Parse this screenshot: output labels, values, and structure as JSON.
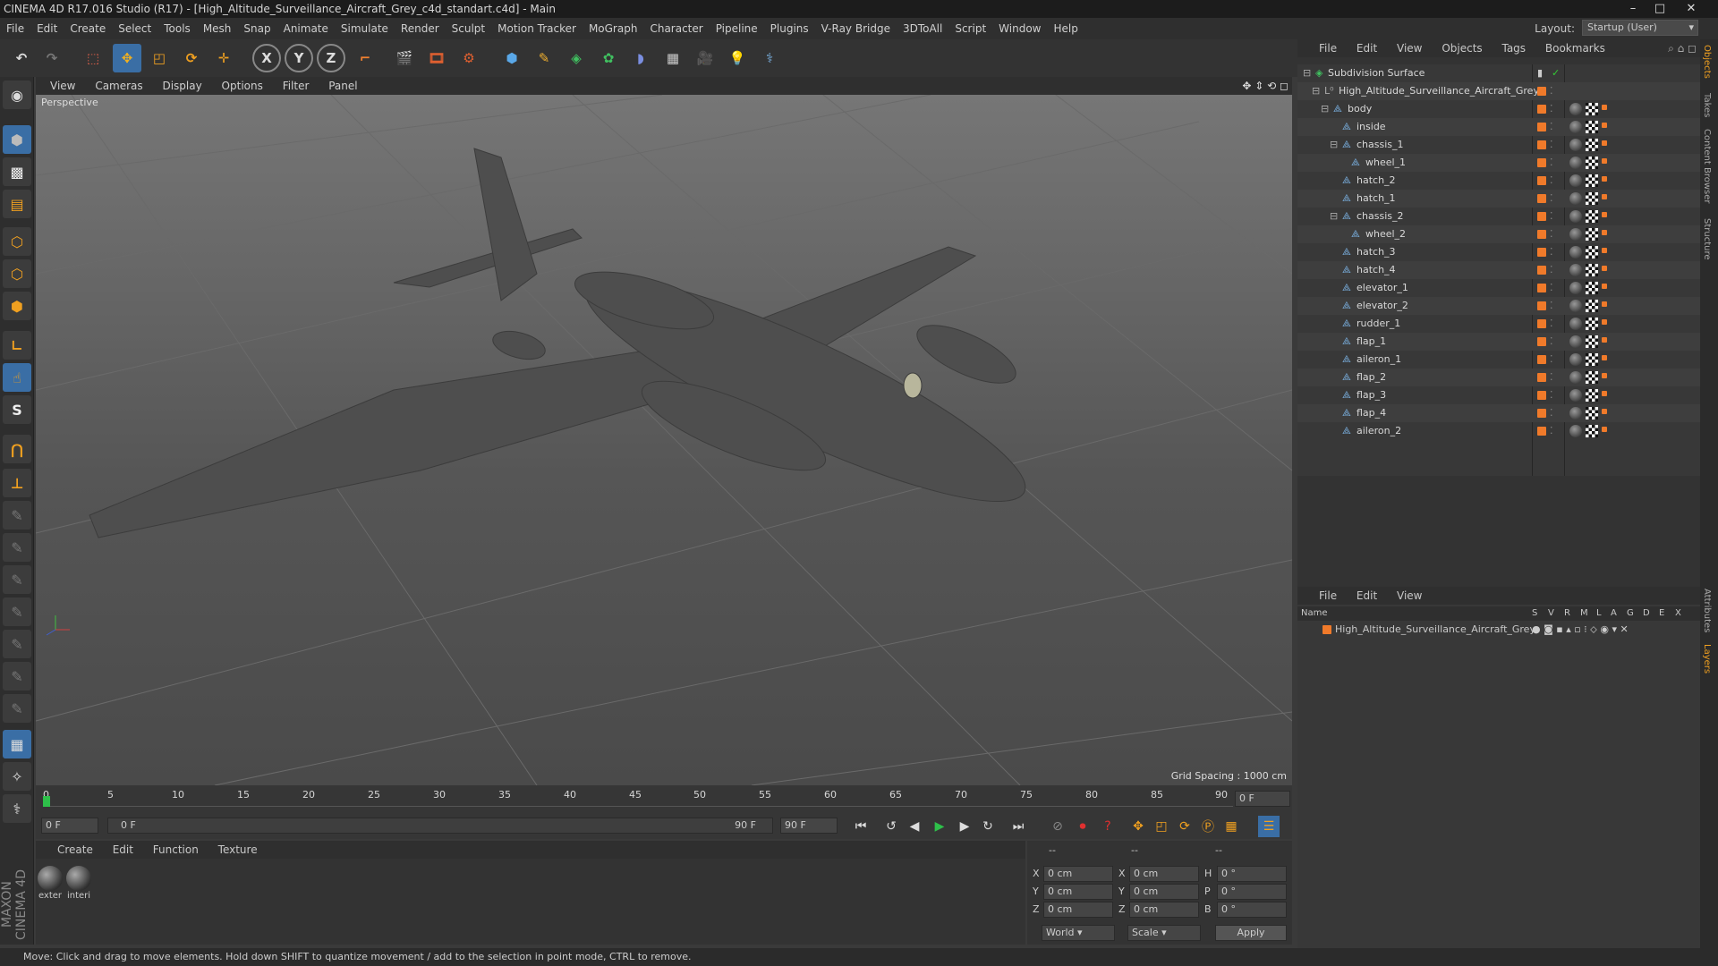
{
  "window": {
    "title": "CINEMA 4D R17.016 Studio (R17) - [High_Altitude_Surveillance_Aircraft_Grey_c4d_standart.c4d] - Main"
  },
  "menubar": {
    "items": [
      "File",
      "Edit",
      "Create",
      "Select",
      "Tools",
      "Mesh",
      "Snap",
      "Animate",
      "Simulate",
      "Render",
      "Sculpt",
      "Motion Tracker",
      "MoGraph",
      "Character",
      "Pipeline",
      "Plugins",
      "V-Ray Bridge",
      "3DToAll",
      "Script",
      "Window",
      "Help"
    ],
    "layout_label": "Layout:",
    "layout_value": "Startup (User)"
  },
  "toolbar": {
    "axis_x": "X",
    "axis_y": "Y",
    "axis_z": "Z"
  },
  "lefttools": {
    "s_label": "S"
  },
  "viewport": {
    "menu": [
      "View",
      "Cameras",
      "Display",
      "Options",
      "Filter",
      "Panel"
    ],
    "label": "Perspective",
    "grid_spacing": "Grid Spacing : 1000 cm"
  },
  "timeline": {
    "ticks": [
      "0",
      "5",
      "10",
      "15",
      "20",
      "25",
      "30",
      "35",
      "40",
      "45",
      "50",
      "55",
      "60",
      "65",
      "70",
      "75",
      "80",
      "85",
      "90"
    ],
    "current_frame_right": "0 F",
    "start_field": "0 F",
    "range_start": "0 F",
    "range_end": "90 F",
    "end_field": "90 F"
  },
  "materials": {
    "menu": [
      "Create",
      "Edit",
      "Function",
      "Texture"
    ],
    "items": [
      {
        "label": "exter"
      },
      {
        "label": "interi"
      }
    ]
  },
  "coords": {
    "headers": [
      "--",
      "--",
      "--"
    ],
    "rows": [
      {
        "a": "X",
        "av": "0 cm",
        "b": "X",
        "bv": "0 cm",
        "c": "H",
        "cv": "0 °"
      },
      {
        "a": "Y",
        "av": "0 cm",
        "b": "Y",
        "bv": "0 cm",
        "c": "P",
        "cv": "0 °"
      },
      {
        "a": "Z",
        "av": "0 cm",
        "b": "Z",
        "bv": "0 cm",
        "c": "B",
        "cv": "0 °"
      }
    ],
    "world": "World",
    "scale": "Scale",
    "apply": "Apply"
  },
  "objects": {
    "menu": [
      "File",
      "Edit",
      "View",
      "Objects",
      "Tags",
      "Bookmarks"
    ],
    "tree": [
      {
        "name": "Subdivision Surface",
        "depth": 0
      },
      {
        "name": "High_Altitude_Surveillance_Aircraft_Grey",
        "depth": 1
      },
      {
        "name": "body",
        "depth": 2
      },
      {
        "name": "inside",
        "depth": 3
      },
      {
        "name": "chassis_1",
        "depth": 3
      },
      {
        "name": "wheel_1",
        "depth": 4
      },
      {
        "name": "hatch_2",
        "depth": 3
      },
      {
        "name": "hatch_1",
        "depth": 3
      },
      {
        "name": "chassis_2",
        "depth": 3
      },
      {
        "name": "wheel_2",
        "depth": 4
      },
      {
        "name": "hatch_3",
        "depth": 3
      },
      {
        "name": "hatch_4",
        "depth": 3
      },
      {
        "name": "elevator_1",
        "depth": 3
      },
      {
        "name": "elevator_2",
        "depth": 3
      },
      {
        "name": "rudder_1",
        "depth": 3
      },
      {
        "name": "flap_1",
        "depth": 3
      },
      {
        "name": "aileron_1",
        "depth": 3
      },
      {
        "name": "flap_2",
        "depth": 3
      },
      {
        "name": "flap_3",
        "depth": 3
      },
      {
        "name": "flap_4",
        "depth": 3
      },
      {
        "name": "aileron_2",
        "depth": 3
      }
    ]
  },
  "layers": {
    "menu": [
      "File",
      "Edit",
      "View"
    ],
    "header_name": "Name",
    "header_cols": [
      "S",
      "V",
      "R",
      "M",
      "L",
      "A",
      "G",
      "D",
      "E",
      "X"
    ],
    "row_name": "High_Altitude_Surveillance_Aircraft_Grey"
  },
  "sidetabs": [
    "Objects",
    "Takes",
    "Content Browser",
    "Structure",
    "Attributes",
    "Layers"
  ],
  "status": "Move: Click and drag to move elements. Hold down SHIFT to quantize movement / add to the selection in point mode, CTRL to remove.",
  "colors": {
    "accent": "#f07a2a",
    "toolbar_blue": "#3a6ea5"
  }
}
